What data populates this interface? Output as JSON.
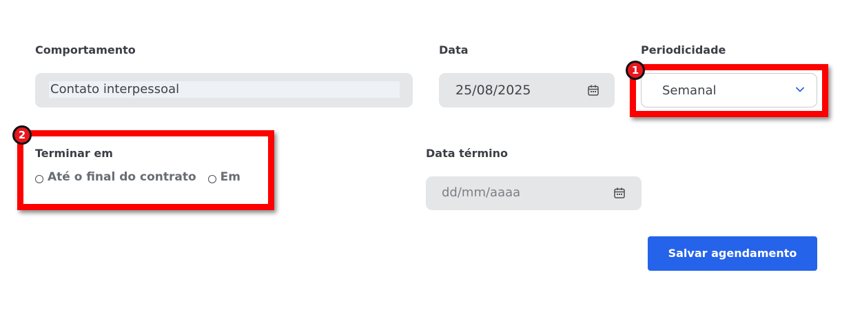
{
  "form": {
    "comportamento": {
      "label": "Comportamento",
      "value": "Contato interpessoal"
    },
    "data": {
      "label": "Data",
      "value": "25/08/2025",
      "icon": "calendar-icon"
    },
    "periodicidade": {
      "label": "Periodicidade",
      "selected": "Semanal",
      "icon": "chevron-down-icon"
    },
    "terminar_em": {
      "label": "Terminar em",
      "options": [
        {
          "label": "Até o final do contrato",
          "checked": false
        },
        {
          "label": "Em",
          "checked": false
        }
      ]
    },
    "data_termino": {
      "label": "Data término",
      "placeholder": "dd/mm/aaaa",
      "icon": "calendar-icon"
    },
    "save_button": {
      "label": "Salvar agendamento",
      "color": "#2563eb"
    }
  },
  "annotations": {
    "color": "#ff0000",
    "badges": [
      {
        "number": "1"
      },
      {
        "number": "2"
      }
    ]
  }
}
